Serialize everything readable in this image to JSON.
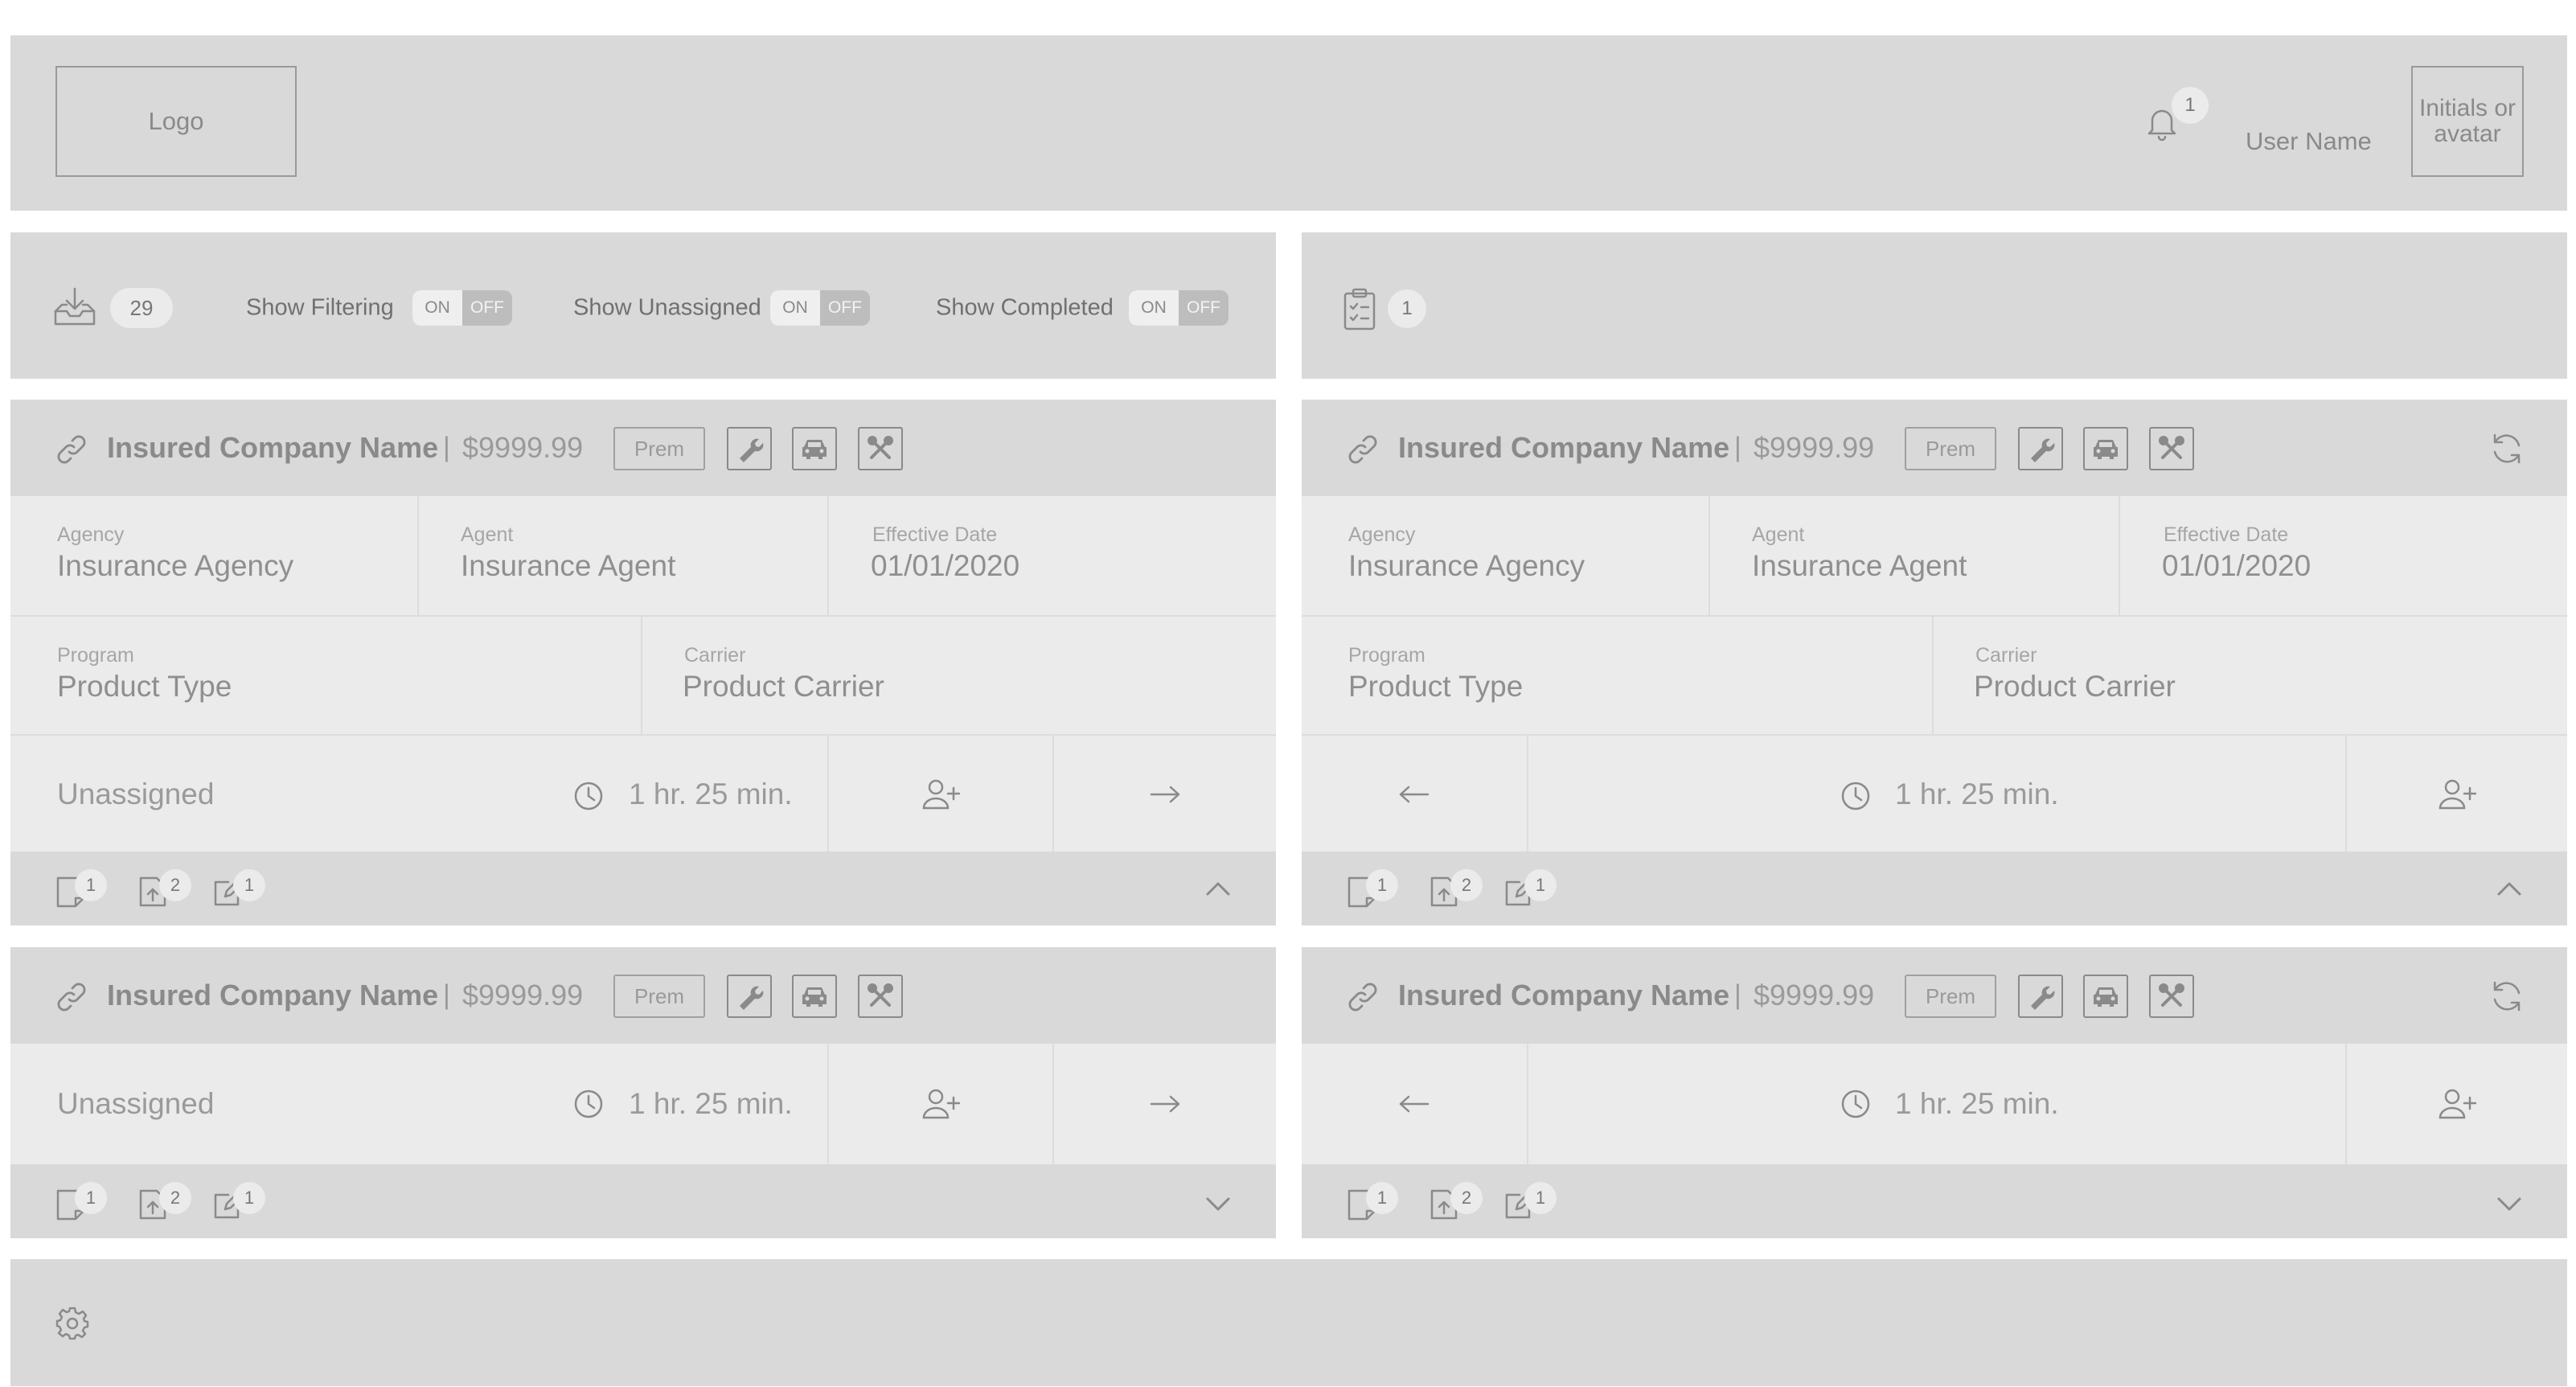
{
  "header": {
    "logo_label": "Logo",
    "notification_count": "1",
    "user_name": "User Name",
    "avatar_label": "Initials or avatar"
  },
  "toolbar": {
    "inbox_count": "29",
    "show_filtering_label": "Show Filtering",
    "show_unassigned_label": "Show Unassigned",
    "show_completed_label": "Show Completed",
    "toggle_on": "ON",
    "toggle_off": "OFF",
    "task_count": "1"
  },
  "cards": [
    {
      "company": "Insured Company Name",
      "separator": "|",
      "price": "$9999.99",
      "prem_label": "Prem",
      "fields": {
        "agency_label": "Agency",
        "agency": "Insurance Agency",
        "agent_label": "Agent",
        "agent": "Insurance Agent",
        "effective_label": "Effective Date",
        "effective": "01/01/2020",
        "program_label": "Program",
        "program": "Product Type",
        "carrier_label": "Carrier",
        "carrier": "Product Carrier"
      },
      "status": "Unassigned",
      "duration": "1 hr. 25 min.",
      "footer_counts": [
        "1",
        "2",
        "1"
      ]
    },
    {
      "company": "Insured Company Name",
      "separator": "|",
      "price": "$9999.99",
      "prem_label": "Prem",
      "fields": {
        "agency_label": "Agency",
        "agency": "Insurance Agency",
        "agent_label": "Agent",
        "agent": "Insurance Agent",
        "effective_label": "Effective Date",
        "effective": "01/01/2020",
        "program_label": "Program",
        "program": "Product Type",
        "carrier_label": "Carrier",
        "carrier": "Product Carrier"
      },
      "duration": "1 hr. 25 min.",
      "footer_counts": [
        "1",
        "2",
        "1"
      ]
    },
    {
      "company": "Insured Company Name",
      "separator": "|",
      "price": "$9999.99",
      "prem_label": "Prem",
      "status": "Unassigned",
      "duration": "1 hr. 25 min.",
      "footer_counts": [
        "1",
        "2",
        "1"
      ]
    },
    {
      "company": "Insured Company Name",
      "separator": "|",
      "price": "$9999.99",
      "prem_label": "Prem",
      "duration": "1 hr. 25 min.",
      "footer_counts": [
        "1",
        "2",
        "1"
      ]
    }
  ],
  "icons": {
    "header": [
      "bell-icon"
    ],
    "toolbar": [
      "inbox-download-icon",
      "clipboard-list-icon"
    ],
    "card_head": [
      "link-icon",
      "wrench-icon",
      "car-icon",
      "tools-icon",
      "refresh-icon"
    ],
    "card_actions": [
      "clock-icon",
      "add-user-icon",
      "arrow-right-icon",
      "arrow-left-icon"
    ],
    "card_footer": [
      "note-icon",
      "upload-file-icon",
      "edit-icon",
      "chevron-up-icon",
      "chevron-down-icon"
    ],
    "footer": [
      "gear-icon"
    ]
  },
  "colors": {
    "panel": "#d9d9d9",
    "panel_light": "#ebebeb",
    "text": "#8a8a8a"
  }
}
